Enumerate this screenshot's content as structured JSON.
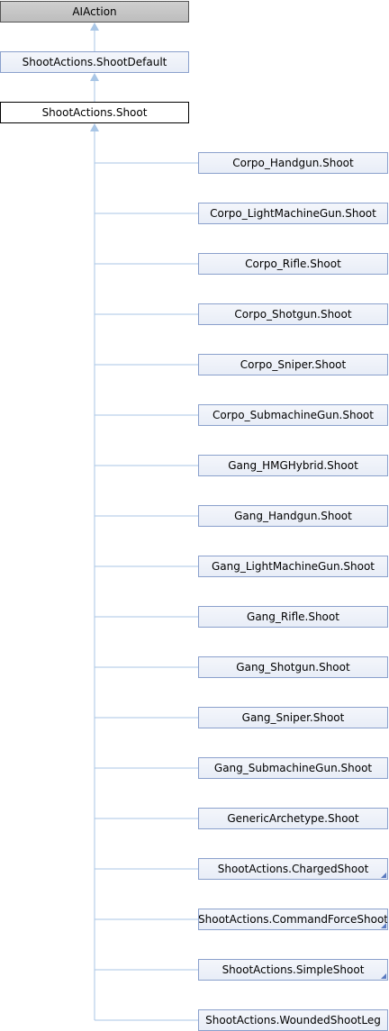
{
  "colors": {
    "edge": "#a9c6e6"
  },
  "hierarchy": {
    "base": "AIAction",
    "parent": "ShootActions.ShootDefault",
    "current": "ShootActions.Shoot",
    "children": [
      {
        "label": "Corpo_Handgun.Shoot",
        "has_more": false
      },
      {
        "label": "Corpo_LightMachineGun.Shoot",
        "has_more": false
      },
      {
        "label": "Corpo_Rifle.Shoot",
        "has_more": false
      },
      {
        "label": "Corpo_Shotgun.Shoot",
        "has_more": false
      },
      {
        "label": "Corpo_Sniper.Shoot",
        "has_more": false
      },
      {
        "label": "Corpo_SubmachineGun.Shoot",
        "has_more": false
      },
      {
        "label": "Gang_HMGHybrid.Shoot",
        "has_more": false
      },
      {
        "label": "Gang_Handgun.Shoot",
        "has_more": false
      },
      {
        "label": "Gang_LightMachineGun.Shoot",
        "has_more": false
      },
      {
        "label": "Gang_Rifle.Shoot",
        "has_more": false
      },
      {
        "label": "Gang_Shotgun.Shoot",
        "has_more": false
      },
      {
        "label": "Gang_Sniper.Shoot",
        "has_more": false
      },
      {
        "label": "Gang_SubmachineGun.Shoot",
        "has_more": false
      },
      {
        "label": "GenericArchetype.Shoot",
        "has_more": false
      },
      {
        "label": "ShootActions.ChargedShoot",
        "has_more": true
      },
      {
        "label": "ShootActions.CommandForceShoot",
        "has_more": true
      },
      {
        "label": "ShootActions.SimpleShoot",
        "has_more": true
      },
      {
        "label": "ShootActions.WoundedShootLeg",
        "has_more": false
      }
    ]
  }
}
